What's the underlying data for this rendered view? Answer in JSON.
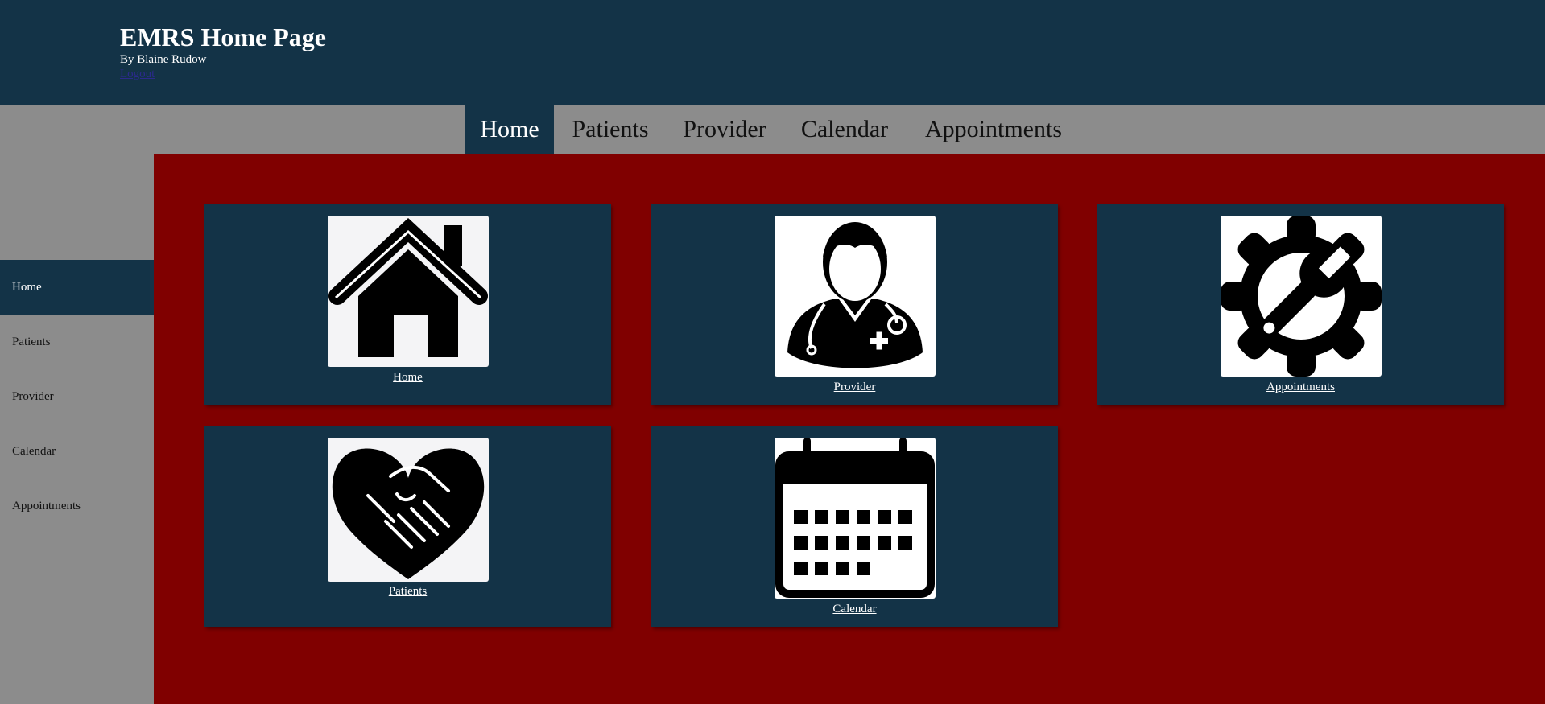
{
  "header": {
    "title": "EMRS Home Page",
    "byline": "By Blaine Rudow",
    "logout": "Logout"
  },
  "topnav": {
    "items": [
      {
        "label": "Home",
        "active": true
      },
      {
        "label": "Patients",
        "active": false
      },
      {
        "label": "Provider",
        "active": false
      },
      {
        "label": "Calendar",
        "active": false
      },
      {
        "label": "Appointments",
        "active": false
      }
    ]
  },
  "sidebar": {
    "items": [
      {
        "label": "Home",
        "active": true
      },
      {
        "label": "Patients",
        "active": false
      },
      {
        "label": "Provider",
        "active": false
      },
      {
        "label": "Calendar",
        "active": false
      },
      {
        "label": "Appointments",
        "active": false
      }
    ]
  },
  "cards": [
    {
      "label": "Home",
      "icon": "house-icon"
    },
    {
      "label": "Provider",
      "icon": "doctor-icon"
    },
    {
      "label": "Appointments",
      "icon": "gear-wrench-icon"
    },
    {
      "label": "Patients",
      "icon": "heart-handshake-icon"
    },
    {
      "label": "Calendar",
      "icon": "calendar-icon"
    }
  ],
  "colors": {
    "header_bg": "#133347",
    "nav_bg": "#8c8c8c",
    "content_bg": "#800000",
    "card_bg": "#133347"
  }
}
